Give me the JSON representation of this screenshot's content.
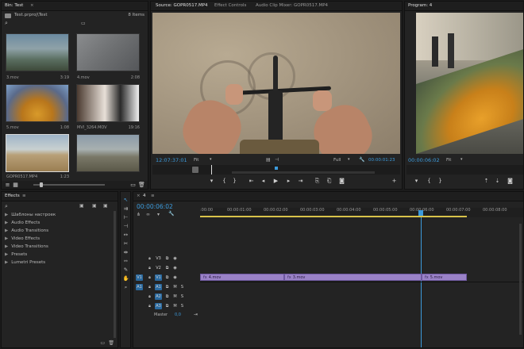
{
  "project": {
    "tab": "Bin: Test",
    "bin_path": "Test.prproj\\Test",
    "item_count": "8 Items",
    "clips": [
      {
        "name": "3.mov",
        "duration": "3:19"
      },
      {
        "name": "4.mov",
        "duration": "2:08"
      },
      {
        "name": "5.mov",
        "duration": "1:08"
      },
      {
        "name": "MVI_3264.MOV",
        "duration": "19:16"
      },
      {
        "name": "GOPR0517.MP4",
        "duration": "1:23"
      },
      {
        "name": "",
        "duration": ""
      }
    ]
  },
  "source": {
    "tabs": [
      "Source: GOPR0517.MP4",
      "Effect Controls",
      "Audio Clip Mixer: GOPR0517.MP4"
    ],
    "timecode": "12:07:37:01",
    "fit": "Fit",
    "quality": "Full",
    "duration": "00:00:01:23"
  },
  "program": {
    "tab": "Program: 4",
    "timecode": "00:00:06:02",
    "fit": "Fit"
  },
  "effects": {
    "tab": "Effects",
    "items": [
      "Шаблоны настроек",
      "Audio Effects",
      "Audio Transitions",
      "Video Effects",
      "Video Transitions",
      "Presets",
      "Lumetri Presets"
    ]
  },
  "timeline": {
    "tab": "4",
    "timecode": "00:00:06:02",
    "ruler": [
      ":00:00",
      "00:00:01:00",
      "00:00:02:00",
      "00:00:03:00",
      "00:00:04:00",
      "00:00:05:00",
      "00:00:06:00",
      "00:00:07:00",
      "00:00:08:00"
    ],
    "video_tracks": [
      "V3",
      "V2",
      "V1"
    ],
    "audio_tracks": [
      "A1",
      "A2",
      "A3"
    ],
    "source_v": "V1",
    "source_a": "A1",
    "master_label": "Master",
    "master_value": "0,0",
    "clips": [
      "4.mov",
      "3.mov",
      "5.mov"
    ],
    "mute": "M",
    "solo": "S"
  }
}
